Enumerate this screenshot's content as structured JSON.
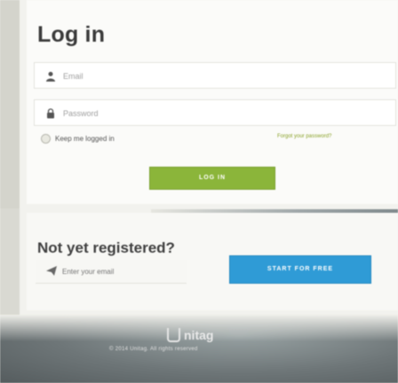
{
  "login": {
    "title": "Log in",
    "email_placeholder": "Email",
    "password_placeholder": "Password",
    "remember_label": "Keep me logged in",
    "forgot_link": "Forgot your password?",
    "login_button": "LOG IN"
  },
  "register": {
    "title": "Not yet registered?",
    "email_placeholder": "Enter your email",
    "start_button": "START FOR FREE"
  },
  "footer": {
    "logo_text": "nitag",
    "copyright": "© 2014 Unitag. All rights reserved"
  },
  "icons": {
    "email": "user-icon",
    "password": "lock-icon",
    "register_email": "paper-plane-icon",
    "brand": "unitag-logo-icon"
  },
  "colors": {
    "login_button": "#8bb53a",
    "start_button": "#2f9bd6",
    "link": "#8aa22a"
  }
}
